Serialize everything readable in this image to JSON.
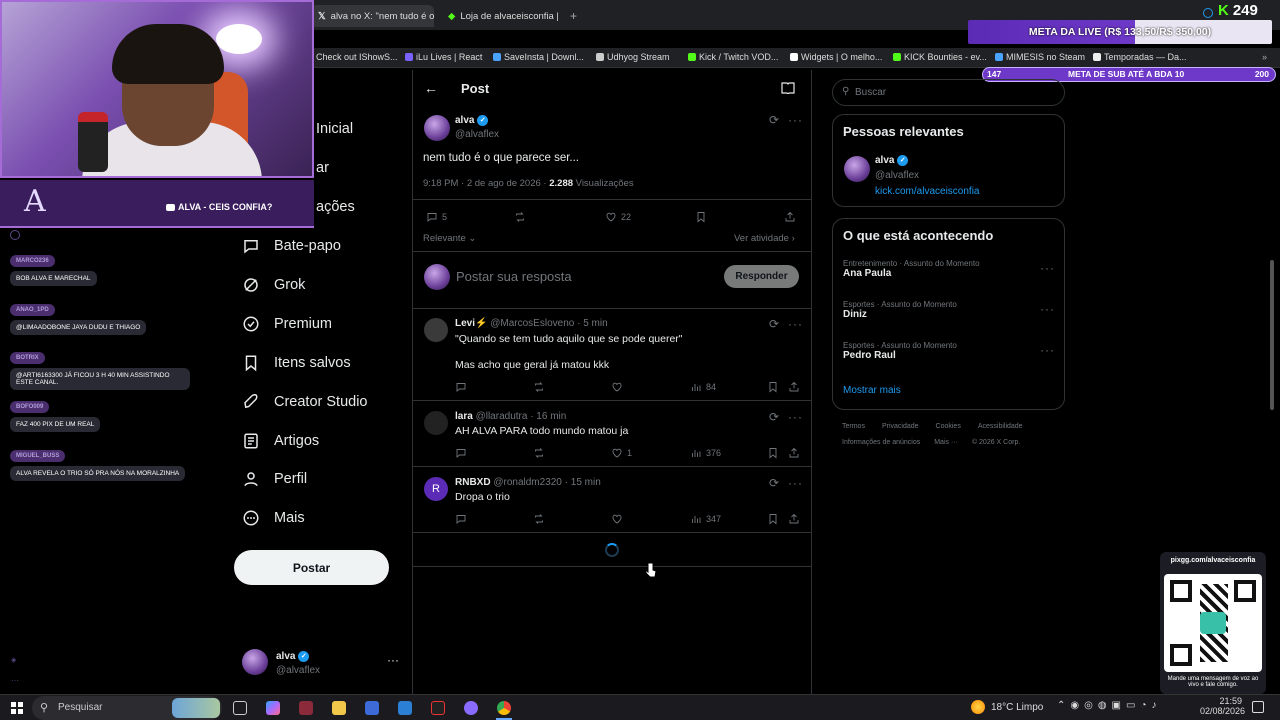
{
  "browser": {
    "tabs": [
      {
        "title": "alva no X: \"nem tudo é o q",
        "active": true
      },
      {
        "title": "Loja de alvaceisconfia | O",
        "active": false
      }
    ],
    "new_tab": "+",
    "bookmarks": [
      "Check out IShowS...",
      "iLu Lives | React",
      "SaveInsta | Downl...",
      "Udhyog Stream",
      "Kick / Twitch VOD...",
      "Widgets | O melho...",
      "KICK Bounties - ev...",
      "MIMESIS no Steam",
      "Temporadas — Da..."
    ]
  },
  "overlay": {
    "kick_count": "249",
    "meta_label": "META DA LIVE (R$ 133,50/R$ 350,00)",
    "sub_left": "147",
    "sub_label": "META DE SUB ATÉ A BDA 10",
    "sub_right": "200",
    "banner_text": "ALVA - CEIS CONFIA?",
    "chat": [
      {
        "name": "MARCO236",
        "text": "BOB ALVA E MARECHAL"
      },
      {
        "name": "ANAO_1PD",
        "text": "@LIMAADOBONE JAYA DUDU E THIAGO"
      },
      {
        "name": "BOTRIX",
        "text": "@ARTI6163300 JÁ FICOU 3 H 40 MIN ASSISTINDO ESTE CANAL."
      },
      {
        "name": "BOFO009",
        "text": "FAZ 400 PIX DE UM REAL"
      },
      {
        "name": "MIGUEL_BUSS",
        "text": "ALVA REVELA O TRIO SÓ PRA NÓS NA MORALZINHA"
      }
    ],
    "qr_url": "pixgg.com/alvaceisconfia",
    "qr_caption": "Mande uma mensagem de voz ao vivo e fale comigo."
  },
  "nav": {
    "partial_top": [
      "Inicial",
      "ar",
      "ações"
    ],
    "items": [
      "Bate-papo",
      "Grok",
      "Premium",
      "Itens salvos",
      "Creator Studio",
      "Artigos",
      "Perfil",
      "Mais"
    ],
    "post_button": "Postar",
    "account_name": "alva",
    "account_handle": "@alvaflex",
    "account_more": "···"
  },
  "post": {
    "header_title": "Post",
    "author_name": "alva",
    "author_handle": "@alvaflex",
    "text": "nem tudo é o que parece ser...",
    "timestamp": "9:18 PM · 2 de ago de 2026 ·",
    "views_count": "2.288",
    "views_label": "Visualizações",
    "replies": "5",
    "likes": "22",
    "sort_label": "Relevante",
    "activity_label": "Ver atividade",
    "reply_placeholder": "Postar sua resposta",
    "reply_button": "Responder"
  },
  "replies": [
    {
      "name": "Levi⚡",
      "handle": "@MarcosEsloveno",
      "time": "· 5 min",
      "lines": [
        "\"Quando se tem tudo aquilo que se pode querer\"",
        "Mas acho que geral já matou kkk"
      ],
      "likes": "",
      "views": "84"
    },
    {
      "name": "lara",
      "handle": "@llaradutra",
      "time": "· 16 min",
      "lines": [
        "AH ALVA PARA todo mundo matou ja"
      ],
      "likes": "1",
      "views": "376"
    },
    {
      "name": "RNBXD",
      "handle": "@ronaldm2320",
      "time": "· 15 min",
      "lines": [
        "Dropa o trio"
      ],
      "likes": "",
      "views": "347",
      "initial": "R"
    }
  ],
  "sidebar": {
    "search_placeholder": "Buscar",
    "relevant_title": "Pessoas relevantes",
    "relevant_name": "alva",
    "relevant_handle": "@alvaflex",
    "relevant_link": "kick.com/alvaceisconfia",
    "trends_title": "O que está acontecendo",
    "trends": [
      {
        "category": "Entretenimento · Assunto do Momento",
        "name": "Ana Paula"
      },
      {
        "category": "Esportes · Assunto do Momento",
        "name": "Diniz"
      },
      {
        "category": "Esportes · Assunto do Momento",
        "name": "Pedro Raul"
      }
    ],
    "show_more": "Mostrar mais",
    "footer_row1": [
      "Termos",
      "Privacidade",
      "Cookies",
      "Acessibilidade"
    ],
    "footer_row2": [
      "Informações de anúncios",
      "Mais ···",
      "© 2026 X Corp."
    ]
  },
  "taskbar": {
    "search": "Pesquisar",
    "weather": "18°C  Limpo",
    "time": "21:59",
    "date": "02/08/2026"
  },
  "colors": {
    "accent": "#1d9bf0",
    "background": "#000000",
    "purple": "#6e38c8"
  }
}
